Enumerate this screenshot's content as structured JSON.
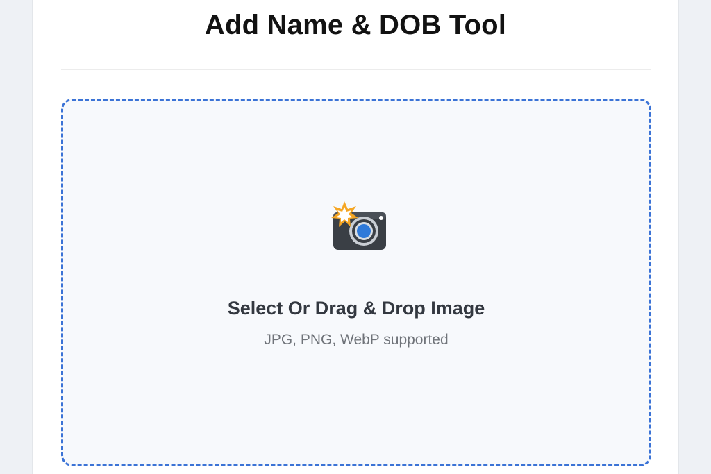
{
  "page": {
    "title": "Add Name & DOB Tool"
  },
  "upload": {
    "icon": "camera-flash-icon",
    "label": "Select Or Drag & Drop Image",
    "hint": "JPG, PNG, WebP supported",
    "border_color": "#3b73d6",
    "background_color": "#f7f9fc"
  }
}
